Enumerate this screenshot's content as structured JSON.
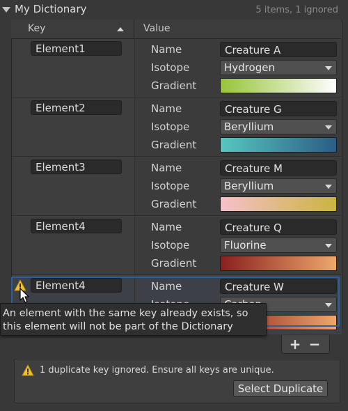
{
  "header": {
    "title": "My Dictionary",
    "count": "5 items, 1 ignored"
  },
  "columns": {
    "key": "Key",
    "value": "Value"
  },
  "labels": {
    "name": "Name",
    "isotope": "Isotope",
    "gradient": "Gradient"
  },
  "rows": [
    {
      "key": "Element1",
      "name": "Creature A",
      "isotope": "Hydrogen",
      "gradient": [
        "#97c43a",
        "#fefefe"
      ]
    },
    {
      "key": "Element2",
      "name": "Creature G",
      "isotope": "Beryllium",
      "gradient": [
        "#57c7bf",
        "#2c5d86"
      ]
    },
    {
      "key": "Element3",
      "name": "Creature M",
      "isotope": "Beryllium",
      "gradient": [
        "#f6c0cb",
        "#c9b53e"
      ]
    },
    {
      "key": "Element4",
      "name": "Creature Q",
      "isotope": "Fluorine",
      "gradient": [
        "#8b1f1f",
        "#eea76c"
      ]
    },
    {
      "key": "Element4",
      "name": "Creature W",
      "isotope": "Carbon",
      "gradient": [
        "#8b1f1f",
        "#eea76c"
      ]
    }
  ],
  "tooltip": {
    "line1": "An element with the same key already exists, so",
    "line2": "this element will not be part of the Dictionary"
  },
  "footer": {
    "add": "+",
    "remove": "−"
  },
  "help": {
    "text": "1 duplicate key ignored. Ensure all keys are unique.",
    "button": "Select Duplicate"
  },
  "colors": {
    "selection": "#2e5f9a",
    "warning": "#f2c22e"
  }
}
